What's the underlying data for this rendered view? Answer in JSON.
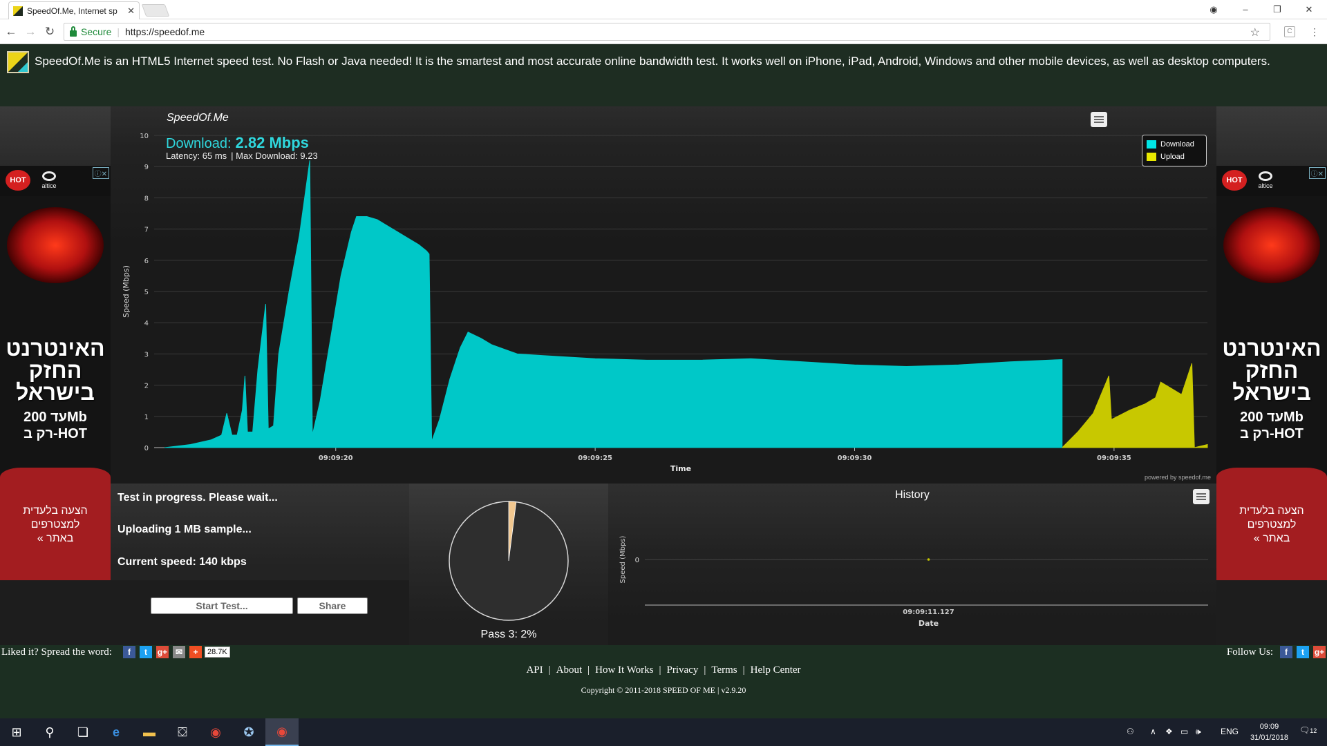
{
  "browser": {
    "tab_title": "SpeedOf.Me, Internet sp",
    "secure_label": "Secure",
    "url": "https://speedof.me"
  },
  "header": {
    "description": "SpeedOf.Me is an HTML5 Internet speed test. No Flash or Java needed! It is the smartest and most accurate online bandwidth test. It works well on iPhone, iPad, Android, Windows and other mobile devices, as well as desktop computers."
  },
  "ads": {
    "brand": "HOT",
    "partner": "altice",
    "headline": "האינטרנט החזק בישראל",
    "offer_line1": "עד 200Mb",
    "offer_line2": "רק ב-HOT",
    "cta_line1": "הצעה בלעדית",
    "cta_line2": "למצטרפים",
    "cta_line3": "באתר »"
  },
  "speed_chart": {
    "brand": "SpeedOf.Me",
    "download_label": "Download:",
    "download_value": "2.82 Mbps",
    "latency": "Latency: 65 ms",
    "max_download": "Max Download: 9.23",
    "separator": "|",
    "powered_by": "powered by speedof.me",
    "colors": {
      "download": "#00c8c8",
      "upload": "#c8c800"
    }
  },
  "status": {
    "line1": "Test in progress. Please wait...",
    "line2": "Uploading 1 MB sample...",
    "line3": "Current speed: 140 kbps"
  },
  "progress": {
    "pass_label": "Pass 3: 2%",
    "percent": 2
  },
  "history": {
    "title": "History",
    "ylabel": "Speed (Mbps)",
    "xlabel": "Date"
  },
  "buttons": {
    "start": "Start Test...",
    "share": "Share"
  },
  "footer": {
    "spread_label": "Liked it? Spread the word:",
    "share_count": "28.7K",
    "follow_label": "Follow Us:",
    "links": [
      "API",
      "About",
      "How It Works",
      "Privacy",
      "Terms",
      "Help Center"
    ],
    "copyright": "Copyright © 2011-2018 SPEED OF ME | v2.9.20"
  },
  "taskbar": {
    "lang": "ENG",
    "time": "09:09",
    "date": "31/01/2018",
    "notifications": "12"
  },
  "chart_data": [
    {
      "type": "area",
      "title": "Download: 2.82 Mbps",
      "xlabel": "Time",
      "ylabel": "Speed (Mbps)",
      "ylim": [
        0,
        10
      ],
      "yticks": [
        0,
        1,
        2,
        3,
        4,
        5,
        6,
        7,
        8,
        9,
        10
      ],
      "xlim": [
        16.5,
        36.8
      ],
      "xticks": [
        {
          "x": 20,
          "label": "09:09:20"
        },
        {
          "x": 25,
          "label": "09:09:25"
        },
        {
          "x": 30,
          "label": "09:09:30"
        },
        {
          "x": 35,
          "label": "09:09:35"
        }
      ],
      "grid": true,
      "legend": "top-right",
      "series": [
        {
          "name": "Download",
          "color": "#00c8c8",
          "points": [
            [
              16.7,
              0
            ],
            [
              17.2,
              0.1
            ],
            [
              17.6,
              0.25
            ],
            [
              17.8,
              0.4
            ],
            [
              17.9,
              1.1
            ],
            [
              18.0,
              0.4
            ],
            [
              18.1,
              0.4
            ],
            [
              18.2,
              1.2
            ],
            [
              18.25,
              2.3
            ],
            [
              18.3,
              0.5
            ],
            [
              18.4,
              0.5
            ],
            [
              18.5,
              2.5
            ],
            [
              18.65,
              4.6
            ],
            [
              18.7,
              0.6
            ],
            [
              18.8,
              0.7
            ],
            [
              18.9,
              3.0
            ],
            [
              19.1,
              5.0
            ],
            [
              19.3,
              6.8
            ],
            [
              19.4,
              8.0
            ],
            [
              19.5,
              9.2
            ],
            [
              19.55,
              0.4
            ],
            [
              19.7,
              1.5
            ],
            [
              19.9,
              3.5
            ],
            [
              20.1,
              5.5
            ],
            [
              20.3,
              6.9
            ],
            [
              20.4,
              7.4
            ],
            [
              20.6,
              7.4
            ],
            [
              20.8,
              7.3
            ],
            [
              21.0,
              7.1
            ],
            [
              21.2,
              6.9
            ],
            [
              21.4,
              6.7
            ],
            [
              21.6,
              6.5
            ],
            [
              21.75,
              6.3
            ],
            [
              21.8,
              6.2
            ],
            [
              21.85,
              0.2
            ],
            [
              22.0,
              0.9
            ],
            [
              22.2,
              2.2
            ],
            [
              22.4,
              3.2
            ],
            [
              22.55,
              3.7
            ],
            [
              22.8,
              3.5
            ],
            [
              23.0,
              3.3
            ],
            [
              23.5,
              3.0
            ],
            [
              24.0,
              2.95
            ],
            [
              25.0,
              2.85
            ],
            [
              26.0,
              2.8
            ],
            [
              27.0,
              2.8
            ],
            [
              28.0,
              2.85
            ],
            [
              29.0,
              2.75
            ],
            [
              30.0,
              2.65
            ],
            [
              31.0,
              2.6
            ],
            [
              32.0,
              2.65
            ],
            [
              33.0,
              2.75
            ],
            [
              34.0,
              2.82
            ],
            [
              34.0,
              0
            ]
          ]
        },
        {
          "name": "Upload",
          "color": "#c8c800",
          "points": [
            [
              34.0,
              0
            ],
            [
              34.3,
              0.5
            ],
            [
              34.6,
              1.1
            ],
            [
              34.9,
              2.3
            ],
            [
              34.95,
              0.9
            ],
            [
              35.3,
              1.2
            ],
            [
              35.6,
              1.4
            ],
            [
              35.8,
              1.6
            ],
            [
              35.9,
              2.1
            ],
            [
              36.1,
              1.9
            ],
            [
              36.3,
              1.7
            ],
            [
              36.5,
              2.7
            ],
            [
              36.55,
              0
            ],
            [
              36.8,
              0.1
            ]
          ]
        }
      ]
    },
    {
      "type": "pie",
      "title": "Pass 3: 2%",
      "slices": [
        {
          "label": "done",
          "value": 2,
          "color": "#f2c890"
        },
        {
          "label": "remaining",
          "value": 98,
          "color": "#303030"
        }
      ]
    },
    {
      "type": "line",
      "title": "History",
      "xlabel": "Date",
      "ylabel": "Speed (Mbps)",
      "yticks": [
        0
      ],
      "xticks": [
        "09:09:11.127"
      ],
      "series": [
        {
          "points": [
            [
              "09:09:11.127",
              0
            ]
          ]
        }
      ]
    }
  ]
}
